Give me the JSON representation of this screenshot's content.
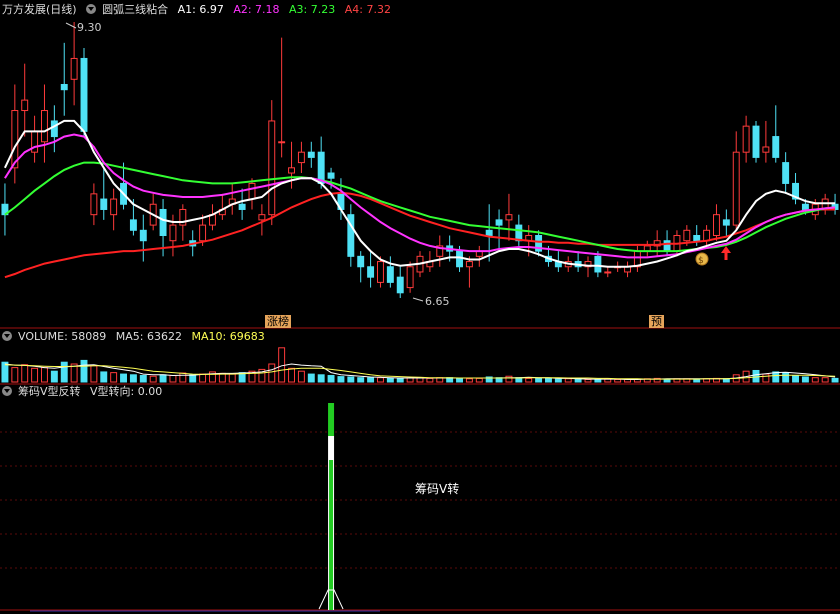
{
  "main": {
    "stock": "万方发展(日线)",
    "indicator": "圆弧三线粘合",
    "a1": "A1: 6.97",
    "a2": "A2: 7.18",
    "a3": "A3: 7.23",
    "a4": "A4: 7.32",
    "high_label": "9.30",
    "low_label": "6.65",
    "tag1": "涨榜",
    "tag2": "预"
  },
  "volume": {
    "label": "VOLUME: 58089",
    "ma5": "MA5: 63622",
    "ma10": "MA10: 69683"
  },
  "sub": {
    "indicator": "筹码V型反转",
    "value": "V型转向: 0.00",
    "signal_text": "筹码V转"
  },
  "colors": {
    "up": "#ff3b3b",
    "down": "#4fe1f5",
    "a1": "#ffffff",
    "a2": "#ff33ff",
    "a3": "#33ff33",
    "a4": "#ff2222",
    "ma5": "#ffffff",
    "ma10": "#ffff55"
  },
  "chart_data": {
    "type": "candlestick",
    "candles": [
      [
        7.55,
        7.75,
        7.25,
        7.45
      ],
      [
        7.9,
        8.7,
        7.75,
        8.45
      ],
      [
        8.45,
        8.9,
        8.2,
        8.55
      ],
      [
        8.05,
        8.4,
        7.95,
        8.25
      ],
      [
        8.15,
        8.7,
        7.95,
        8.45
      ],
      [
        8.35,
        8.5,
        8.05,
        8.2
      ],
      [
        8.7,
        9.1,
        8.4,
        8.65
      ],
      [
        8.75,
        9.3,
        8.5,
        8.95
      ],
      [
        8.95,
        9.05,
        8.2,
        8.25
      ],
      [
        7.45,
        7.75,
        7.35,
        7.65
      ],
      [
        7.6,
        7.9,
        7.4,
        7.5
      ],
      [
        7.45,
        7.7,
        7.3,
        7.6
      ],
      [
        7.75,
        7.95,
        7.5,
        7.55
      ],
      [
        7.4,
        7.6,
        7.25,
        7.3
      ],
      [
        7.3,
        7.45,
        7.0,
        7.2
      ],
      [
        7.35,
        7.65,
        7.3,
        7.55
      ],
      [
        7.5,
        7.6,
        7.05,
        7.25
      ],
      [
        7.2,
        7.45,
        7.05,
        7.35
      ],
      [
        7.35,
        7.55,
        7.2,
        7.5
      ],
      [
        7.2,
        7.3,
        7.05,
        7.15
      ],
      [
        7.2,
        7.45,
        7.15,
        7.35
      ],
      [
        7.35,
        7.55,
        7.3,
        7.45
      ],
      [
        7.45,
        7.65,
        7.4,
        7.5
      ],
      [
        7.55,
        7.75,
        7.45,
        7.6
      ],
      [
        7.55,
        7.7,
        7.4,
        7.5
      ],
      [
        7.6,
        7.8,
        7.5,
        7.75
      ],
      [
        7.4,
        7.55,
        7.25,
        7.45
      ],
      [
        7.45,
        8.55,
        7.35,
        8.35
      ],
      [
        8.15,
        9.15,
        8.0,
        8.15
      ],
      [
        7.85,
        8.15,
        7.7,
        7.9
      ],
      [
        7.95,
        8.15,
        7.85,
        8.05
      ],
      [
        8.05,
        8.15,
        7.9,
        8.0
      ],
      [
        8.05,
        8.2,
        7.7,
        7.75
      ],
      [
        7.85,
        7.9,
        7.7,
        7.8
      ],
      [
        7.65,
        7.8,
        7.4,
        7.5
      ],
      [
        7.45,
        7.55,
        6.95,
        7.05
      ],
      [
        7.05,
        7.1,
        6.8,
        6.95
      ],
      [
        6.95,
        7.1,
        6.75,
        6.85
      ],
      [
        6.8,
        7.05,
        6.75,
        7.0
      ],
      [
        6.95,
        7.05,
        6.75,
        6.8
      ],
      [
        6.85,
        6.95,
        6.65,
        6.7
      ],
      [
        6.75,
        7.0,
        6.7,
        6.95
      ],
      [
        6.9,
        7.1,
        6.85,
        7.05
      ],
      [
        6.95,
        7.1,
        6.9,
        7.0
      ],
      [
        7.05,
        7.25,
        6.95,
        7.15
      ],
      [
        7.15,
        7.25,
        7.0,
        7.1
      ],
      [
        7.1,
        7.15,
        6.9,
        6.95
      ],
      [
        6.95,
        7.05,
        6.75,
        7.0
      ],
      [
        7.05,
        7.15,
        6.95,
        7.1
      ],
      [
        7.3,
        7.55,
        7.0,
        7.25
      ],
      [
        7.4,
        7.5,
        7.1,
        7.35
      ],
      [
        7.4,
        7.65,
        7.2,
        7.45
      ],
      [
        7.35,
        7.45,
        7.15,
        7.2
      ],
      [
        7.2,
        7.35,
        7.05,
        7.25
      ],
      [
        7.25,
        7.3,
        7.05,
        7.1
      ],
      [
        7.05,
        7.15,
        6.95,
        7.0
      ],
      [
        7.0,
        7.1,
        6.9,
        6.95
      ],
      [
        6.95,
        7.05,
        6.9,
        7.0
      ],
      [
        7.0,
        7.1,
        6.9,
        6.95
      ],
      [
        6.95,
        7.05,
        6.85,
        7.0
      ],
      [
        7.05,
        7.1,
        6.85,
        6.9
      ],
      [
        6.9,
        6.95,
        6.85,
        6.9
      ],
      [
        6.95,
        7.0,
        6.9,
        6.95
      ],
      [
        6.9,
        7.0,
        6.85,
        6.95
      ],
      [
        6.95,
        7.15,
        6.9,
        7.1
      ],
      [
        7.1,
        7.2,
        7.05,
        7.15
      ],
      [
        7.15,
        7.3,
        7.05,
        7.2
      ],
      [
        7.2,
        7.3,
        7.05,
        7.1
      ],
      [
        7.1,
        7.3,
        7.05,
        7.25
      ],
      [
        7.2,
        7.35,
        7.15,
        7.3
      ],
      [
        7.25,
        7.35,
        7.15,
        7.2
      ],
      [
        7.2,
        7.35,
        7.15,
        7.3
      ],
      [
        7.25,
        7.55,
        7.2,
        7.45
      ],
      [
        7.4,
        7.5,
        7.25,
        7.35
      ],
      [
        7.35,
        8.25,
        7.3,
        8.05
      ],
      [
        8.05,
        8.4,
        7.95,
        8.3
      ],
      [
        8.3,
        8.35,
        7.95,
        8.0
      ],
      [
        8.05,
        8.35,
        7.95,
        8.1
      ],
      [
        8.2,
        8.5,
        7.95,
        8.0
      ],
      [
        7.95,
        8.05,
        7.65,
        7.75
      ],
      [
        7.75,
        7.85,
        7.55,
        7.6
      ],
      [
        7.55,
        7.6,
        7.45,
        7.5
      ],
      [
        7.45,
        7.6,
        7.4,
        7.55
      ],
      [
        7.5,
        7.65,
        7.45,
        7.6
      ],
      [
        7.55,
        7.65,
        7.45,
        7.5
      ]
    ],
    "a1": [
      7.9,
      8.1,
      8.25,
      8.25,
      8.25,
      8.3,
      8.35,
      8.35,
      8.25,
      8.05,
      7.9,
      7.75,
      7.65,
      7.55,
      7.5,
      7.45,
      7.4,
      7.38,
      7.38,
      7.4,
      7.42,
      7.45,
      7.5,
      7.55,
      7.58,
      7.6,
      7.62,
      7.7,
      7.75,
      7.78,
      7.8,
      7.8,
      7.75,
      7.65,
      7.5,
      7.35,
      7.2,
      7.1,
      7.02,
      6.98,
      6.96,
      6.97,
      6.98,
      7.0,
      7.02,
      7.04,
      7.04,
      7.02,
      7.02,
      7.06,
      7.1,
      7.12,
      7.12,
      7.1,
      7.07,
      7.03,
      7.0,
      6.98,
      6.97,
      6.96,
      6.96,
      6.95,
      6.95,
      6.95,
      6.96,
      6.98,
      7.0,
      7.03,
      7.06,
      7.1,
      7.12,
      7.15,
      7.18,
      7.2,
      7.3,
      7.45,
      7.58,
      7.65,
      7.68,
      7.66,
      7.62,
      7.58,
      7.56,
      7.56,
      7.56
    ],
    "a2": [
      7.8,
      7.95,
      8.05,
      8.1,
      8.12,
      8.15,
      8.2,
      8.22,
      8.2,
      8.1,
      7.95,
      7.85,
      7.78,
      7.72,
      7.68,
      7.66,
      7.64,
      7.63,
      7.62,
      7.62,
      7.62,
      7.63,
      7.64,
      7.66,
      7.68,
      7.7,
      7.72,
      7.74,
      7.76,
      7.78,
      7.8,
      7.8,
      7.78,
      7.74,
      7.68,
      7.6,
      7.52,
      7.45,
      7.38,
      7.32,
      7.27,
      7.22,
      7.18,
      7.15,
      7.13,
      7.12,
      7.11,
      7.1,
      7.1,
      7.1,
      7.12,
      7.13,
      7.14,
      7.14,
      7.13,
      7.12,
      7.11,
      7.1,
      7.09,
      7.08,
      7.07,
      7.06,
      7.05,
      7.04,
      7.04,
      7.04,
      7.05,
      7.06,
      7.07,
      7.09,
      7.11,
      7.13,
      7.15,
      7.17,
      7.21,
      7.27,
      7.33,
      7.38,
      7.42,
      7.45,
      7.47,
      7.49,
      7.5,
      7.51,
      7.52
    ],
    "a3": [
      7.45,
      7.52,
      7.6,
      7.68,
      7.75,
      7.82,
      7.88,
      7.92,
      7.95,
      7.95,
      7.94,
      7.92,
      7.9,
      7.88,
      7.86,
      7.84,
      7.82,
      7.8,
      7.78,
      7.77,
      7.76,
      7.75,
      7.75,
      7.75,
      7.76,
      7.77,
      7.78,
      7.79,
      7.8,
      7.81,
      7.81,
      7.8,
      7.78,
      7.76,
      7.73,
      7.7,
      7.66,
      7.62,
      7.58,
      7.55,
      7.52,
      7.49,
      7.46,
      7.43,
      7.41,
      7.39,
      7.37,
      7.35,
      7.34,
      7.33,
      7.32,
      7.31,
      7.3,
      7.29,
      7.28,
      7.26,
      7.24,
      7.22,
      7.2,
      7.18,
      7.16,
      7.14,
      7.12,
      7.11,
      7.1,
      7.1,
      7.1,
      7.1,
      7.1,
      7.11,
      7.12,
      7.13,
      7.14,
      7.16,
      7.19,
      7.23,
      7.28,
      7.33,
      7.37,
      7.41,
      7.44,
      7.47,
      7.49,
      7.51,
      7.52
    ],
    "a4": [
      6.85,
      6.88,
      6.92,
      6.95,
      6.98,
      7.0,
      7.02,
      7.04,
      7.06,
      7.07,
      7.08,
      7.09,
      7.1,
      7.1,
      7.11,
      7.12,
      7.13,
      7.14,
      7.15,
      7.17,
      7.19,
      7.21,
      7.24,
      7.27,
      7.3,
      7.34,
      7.38,
      7.42,
      7.47,
      7.52,
      7.56,
      7.6,
      7.63,
      7.65,
      7.66,
      7.65,
      7.63,
      7.6,
      7.56,
      7.52,
      7.48,
      7.44,
      7.41,
      7.38,
      7.35,
      7.32,
      7.3,
      7.28,
      7.26,
      7.24,
      7.23,
      7.22,
      7.21,
      7.2,
      7.19,
      7.19,
      7.18,
      7.18,
      7.17,
      7.17,
      7.16,
      7.16,
      7.16,
      7.16,
      7.16,
      7.16,
      7.16,
      7.17,
      7.17,
      7.18,
      7.19,
      7.2,
      7.22,
      7.24,
      7.27,
      7.3,
      7.34,
      7.38,
      7.42,
      7.45,
      7.47,
      7.49,
      7.5,
      7.5,
      7.5
    ],
    "volume": [
      55,
      40,
      48,
      38,
      40,
      30,
      55,
      50,
      60,
      45,
      28,
      26,
      22,
      20,
      18,
      16,
      20,
      18,
      25,
      20,
      22,
      28,
      24,
      22,
      26,
      30,
      35,
      50,
      95,
      38,
      30,
      22,
      20,
      18,
      15,
      14,
      12,
      12,
      12,
      11,
      10,
      11,
      11,
      10,
      12,
      12,
      10,
      9,
      10,
      14,
      12,
      16,
      12,
      10,
      11,
      10,
      8,
      9,
      8,
      7,
      7,
      8,
      7,
      7,
      8,
      9,
      10,
      8,
      9,
      9,
      8,
      9,
      10,
      9,
      20,
      30,
      32,
      22,
      28,
      25,
      18,
      14,
      12,
      12,
      10
    ],
    "vol_ma5": [
      50,
      47,
      46,
      44,
      40,
      38,
      42,
      44,
      47,
      48,
      43,
      38,
      34,
      30,
      22,
      20,
      20,
      18,
      19,
      19,
      21,
      23,
      24,
      24,
      25,
      26,
      28,
      34,
      45,
      50,
      47,
      45,
      44,
      26,
      20,
      18,
      16,
      14,
      13,
      12,
      11,
      11,
      11,
      11,
      11,
      11,
      11,
      11,
      11,
      11,
      11,
      12,
      12,
      13,
      12,
      12,
      10,
      10,
      9,
      8,
      8,
      8,
      8,
      7,
      7,
      8,
      8,
      9,
      9,
      9,
      9,
      9,
      9,
      9,
      11,
      15,
      20,
      23,
      26,
      27,
      25,
      23,
      20,
      17,
      14
    ],
    "vol_ma10": [
      48,
      47,
      46,
      45,
      44,
      43,
      43,
      44,
      44,
      45,
      45,
      43,
      41,
      38,
      34,
      30,
      28,
      26,
      24,
      22,
      21,
      21,
      22,
      22,
      23,
      24,
      25,
      28,
      33,
      36,
      38,
      38,
      38,
      35,
      32,
      28,
      24,
      20,
      17,
      16,
      15,
      14,
      13,
      12,
      12,
      12,
      11,
      11,
      11,
      11,
      11,
      11,
      11,
      12,
      12,
      12,
      12,
      11,
      11,
      11,
      10,
      10,
      9,
      9,
      9,
      8,
      8,
      8,
      8,
      8,
      8,
      9,
      9,
      9,
      10,
      12,
      14,
      16,
      18,
      19,
      19,
      19,
      18,
      17,
      16
    ],
    "v_signal_index": 33
  }
}
